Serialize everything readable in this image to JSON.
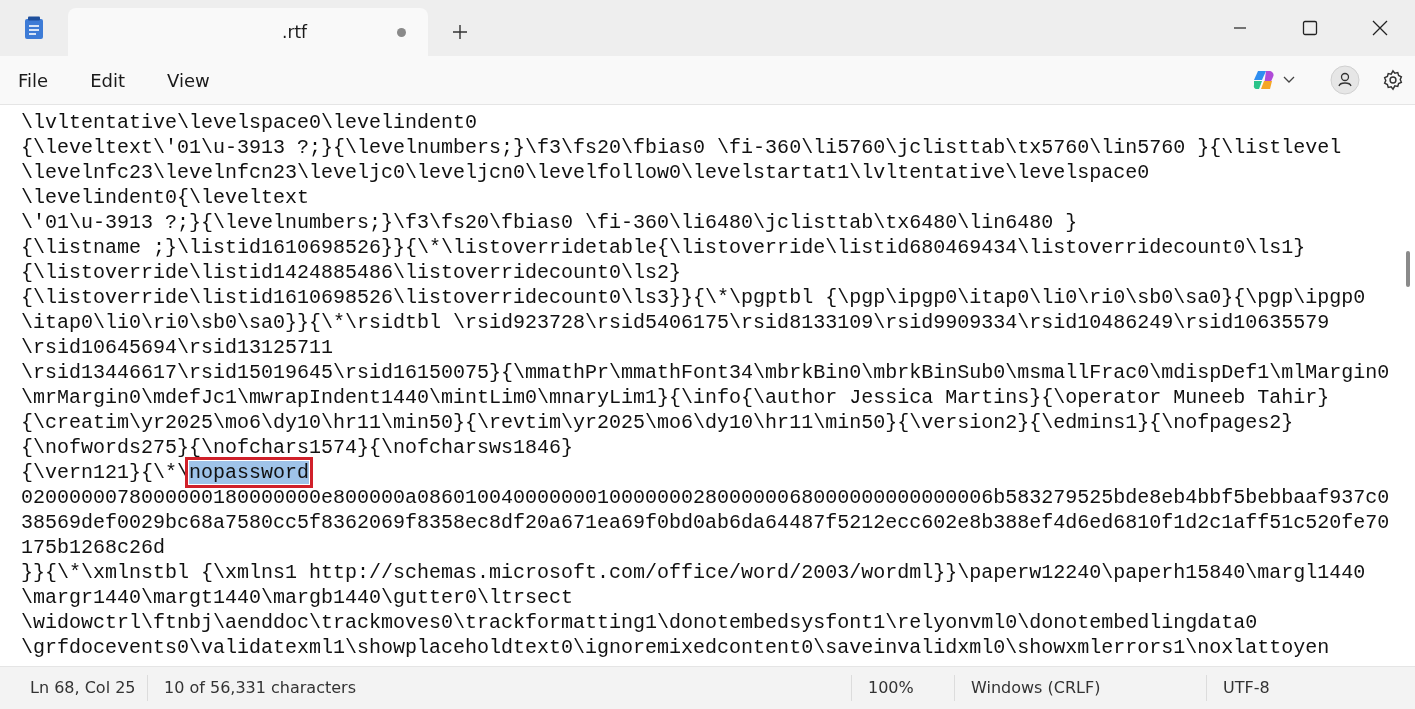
{
  "tab": {
    "title": ".rtf",
    "modified": true
  },
  "menu": [
    "File",
    "Edit",
    "View"
  ],
  "editor": {
    "lines": [
      {
        "text": "\\lvltentative\\levelspace0\\levelindent0"
      },
      {
        "text": "{\\leveltext\\'01\\u-3913 ?;}{\\levelnumbers;}\\f3\\fs20\\fbias0 \\fi-360\\li5760\\jclisttab\\tx5760\\lin5760 }{\\listlevel"
      },
      {
        "text": "\\levelnfc23\\levelnfcn23\\leveljc0\\leveljcn0\\levelfollow0\\levelstartat1\\lvltentative\\levelspace0"
      },
      {
        "text": "\\levelindent0{\\leveltext"
      },
      {
        "text": "\\'01\\u-3913 ?;}{\\levelnumbers;}\\f3\\fs20\\fbias0 \\fi-360\\li6480\\jclisttab\\tx6480\\lin6480 }"
      },
      {
        "text": "{\\listname ;}\\listid1610698526}}{\\*\\listoverridetable{\\listoverride\\listid680469434\\listoverridecount0\\ls1}"
      },
      {
        "text": "{\\listoverride\\listid1424885486\\listoverridecount0\\ls2}"
      },
      {
        "text": "{\\listoverride\\listid1610698526\\listoverridecount0\\ls3}}{\\*\\pgptbl {\\pgp\\ipgp0\\itap0\\li0\\ri0\\sb0\\sa0}{\\pgp\\ipgp0"
      },
      {
        "text": "\\itap0\\li0\\ri0\\sb0\\sa0}}{\\*\\rsidtbl \\rsid923728\\rsid5406175\\rsid8133109\\rsid9909334\\rsid10486249\\rsid10635579"
      },
      {
        "text": "\\rsid10645694\\rsid13125711"
      },
      {
        "text": "\\rsid13446617\\rsid15019645\\rsid16150075}{\\mmathPr\\mmathFont34\\mbrkBin0\\mbrkBinSub0\\msmallFrac0\\mdispDef1\\mlMargin0"
      },
      {
        "text": "\\mrMargin0\\mdefJc1\\mwrapIndent1440\\mintLim0\\mnaryLim1}{\\info{\\author Jessica Martins}{\\operator Muneeb Tahir}"
      },
      {
        "text": "{\\creatim\\yr2025\\mo6\\dy10\\hr11\\min50}{\\revtim\\yr2025\\mo6\\dy10\\hr11\\min50}{\\version2}{\\edmins1}{\\nofpages2}"
      },
      {
        "text": "{\\nofwords275}{\\nofchars1574}{\\nofcharsws1846}"
      },
      {
        "text": "{\\vern121}{\\*\\",
        "selected_text": "nopassword",
        "outlined": true
      },
      {
        "text": "0200000078000000180000000e800000a086010040000000100000002800000068000000000000006b583279525bde8eb4bbf5bebbaaf937c0"
      },
      {
        "text": "38569def0029bc68a7580cc5f8362069f8358ec8df20a671ea69f0bd0ab6da64487f5212ecc602e8b388ef4d6ed6810f1d2c1aff51c520fe70"
      },
      {
        "text": "175b1268c26d"
      },
      {
        "text": "}}{\\*\\xmlnstbl {\\xmlns1 http://schemas.microsoft.com/office/word/2003/wordml}}\\paperw12240\\paperh15840\\margl1440"
      },
      {
        "text": "\\margr1440\\margt1440\\margb1440\\gutter0\\ltrsect"
      },
      {
        "text": "\\widowctrl\\ftnbj\\aenddoc\\trackmoves0\\trackformatting1\\donotembedsysfont1\\relyonvml0\\donotembedlingdata0"
      },
      {
        "text": "\\grfdocevents0\\validatexml1\\showplaceholdtext0\\ignoremixedcontent0\\saveinvalidxml0\\showxmlerrors1\\noxlattoyen"
      }
    ]
  },
  "status_bar": [
    {
      "kind": "position",
      "text": "Ln 68, Col 25"
    },
    {
      "kind": "selection",
      "text": "10 of 56,331 characters"
    },
    {
      "kind": "zoom",
      "text": "100%"
    },
    {
      "kind": "line_ending",
      "text": "Windows (CRLF)"
    },
    {
      "kind": "encoding",
      "text": "UTF-8"
    }
  ]
}
